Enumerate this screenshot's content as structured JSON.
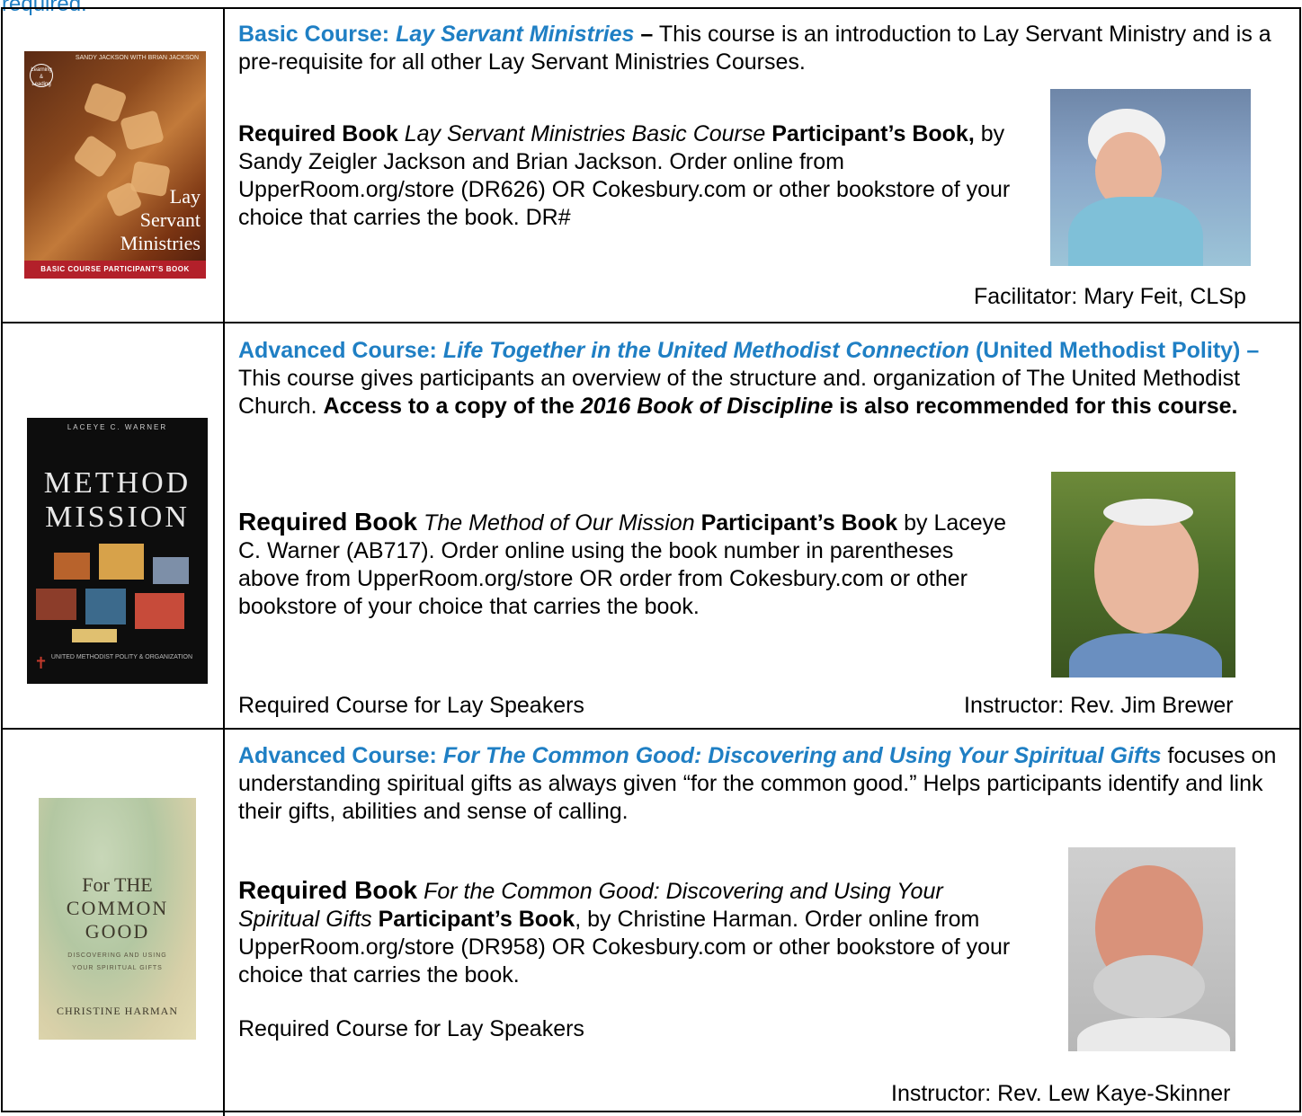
{
  "top_cut_text": "required.",
  "courses": [
    {
      "heading_label": "Basic Course: ",
      "heading_title": "Lay Servant Ministries",
      "heading_dash": " –",
      "description": "This course is an introduction to Lay Servant Ministry and is a pre-requisite for all other Lay Servant Ministries Courses.",
      "req_label": "Required Book",
      "req_title": "Lay Servant Ministries Basic Course",
      "req_pb": "Participant’s Book,",
      "req_rest": "by Sandy Zeigler Jackson and Brian Jackson. Order online from UpperRoom.org/store (DR626) OR Cokesbury.com or other bookstore of your choice that carries the book. DR#",
      "footer_right": "Facilitator: Mary Feit, CLSp",
      "cover": {
        "authors": "SANDY JACKSON WITH BRIAN JACKSON",
        "badge": "Learning & Leading",
        "title_lines": [
          "Lay",
          "Servant",
          "Ministries"
        ],
        "band": "BASIC COURSE PARTICIPANT’S BOOK"
      },
      "photo_icon": "facilitator-photo"
    },
    {
      "heading_label": "Advanced Course: ",
      "heading_title": "Life Together in the United Methodist Connection",
      "heading_rest": " (United Methodist Polity) –",
      "description": "This course gives participants an overview of the structure and. organization of The United Methodist Church.",
      "note_pre": "Access to a copy of the",
      "note_title": "2016 Book of Discipline",
      "note_post": "is also recommended for this course.",
      "req_label": "Required Book",
      "req_title": "The Method of Our Mission",
      "req_pb": "Participant’s Book",
      "req_rest": "by Laceye C. Warner (AB717). Order online using the book number in parentheses above from UpperRoom.org/store OR order from Cokesbury.com or other bookstore of your choice that carries the book.",
      "footer_left": "Required Course for Lay Speakers",
      "footer_right": "Instructor: Rev. Jim Brewer",
      "cover": {
        "author": "LACEYE C. WARNER",
        "line1": "METHOD",
        "line2": "MISSION",
        "sub": "UNITED METHODIST POLITY & ORGANIZATION"
      }
    },
    {
      "heading_label": "Advanced Course: ",
      "heading_title": "For The Common Good: Discovering and Using Your Spiritual Gifts",
      "description": "focuses on understanding spiritual gifts as always given “for the common good.” Helps participants identify and link their gifts, abilities and sense of calling.",
      "req_label": "Required Book",
      "req_title": "For the Common Good: Discovering and Using Your Spiritual Gifts",
      "req_pb": "Participant’s Book",
      "req_rest": ", by Christine Harman. Order online from UpperRoom.org/store (DR958) OR Cokesbury.com or other bookstore of your choice that carries the book.",
      "footer_left": "Required Course for Lay Speakers",
      "footer_right": "Instructor: Rev. Lew Kaye-Skinner",
      "cover": {
        "line1": "For THE",
        "line2": "COMMON",
        "line3": "GOOD",
        "sub1": "DISCOVERING AND USING",
        "sub2": "YOUR SPIRITUAL GIFTS",
        "author": "CHRISTINE HARMAN"
      }
    }
  ]
}
